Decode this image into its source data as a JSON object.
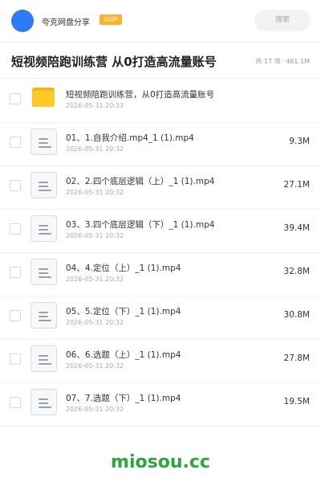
{
  "header": {
    "brand": "夸克网盘分享",
    "badge": "SVIP",
    "search_label": "搜索",
    "avatar_color": "#2f7bf5",
    "badge_color": "#ffb02e"
  },
  "folder": {
    "title": "短视频陪跑训练营 从0打造高流量账号",
    "count": "共 17 项",
    "size": "461.1M"
  },
  "items": [
    {
      "type": "folder",
      "icon": "folder-icon",
      "name": "短视频陪跑训练营，从0打造高流量账号",
      "date": "2026-05-31 20:33",
      "size": ""
    },
    {
      "type": "file",
      "icon": "file-icon",
      "name": "01、1.自我介绍.mp4_1 (1).mp4",
      "date": "2026-05-31 20:32",
      "size": "9.3M"
    },
    {
      "type": "file",
      "icon": "file-icon",
      "name": "02、2.四个底层逻辑（上）_1 (1).mp4",
      "date": "2026-05-31 20:32",
      "size": "27.1M"
    },
    {
      "type": "file",
      "icon": "file-icon",
      "name": "03、3.四个底层逻辑（下）_1 (1).mp4",
      "date": "2026-05-31 20:32",
      "size": "39.4M"
    },
    {
      "type": "file",
      "icon": "file-icon",
      "name": "04、4.定位（上）_1 (1).mp4",
      "date": "2026-05-31 20:32",
      "size": "32.8M"
    },
    {
      "type": "file",
      "icon": "file-icon",
      "name": "05、5.定位（下）_1 (1).mp4",
      "date": "2026-05-31 20:32",
      "size": "30.8M"
    },
    {
      "type": "file",
      "icon": "file-icon",
      "name": "06、6.选题（上）_1 (1).mp4",
      "date": "2026-05-31 20:32",
      "size": "27.8M"
    },
    {
      "type": "file",
      "icon": "file-icon",
      "name": "07、7.选题（下）_1 (1).mp4",
      "date": "2026-05-31 20:32",
      "size": "19.5M"
    }
  ],
  "watermark": "miosou.cc"
}
